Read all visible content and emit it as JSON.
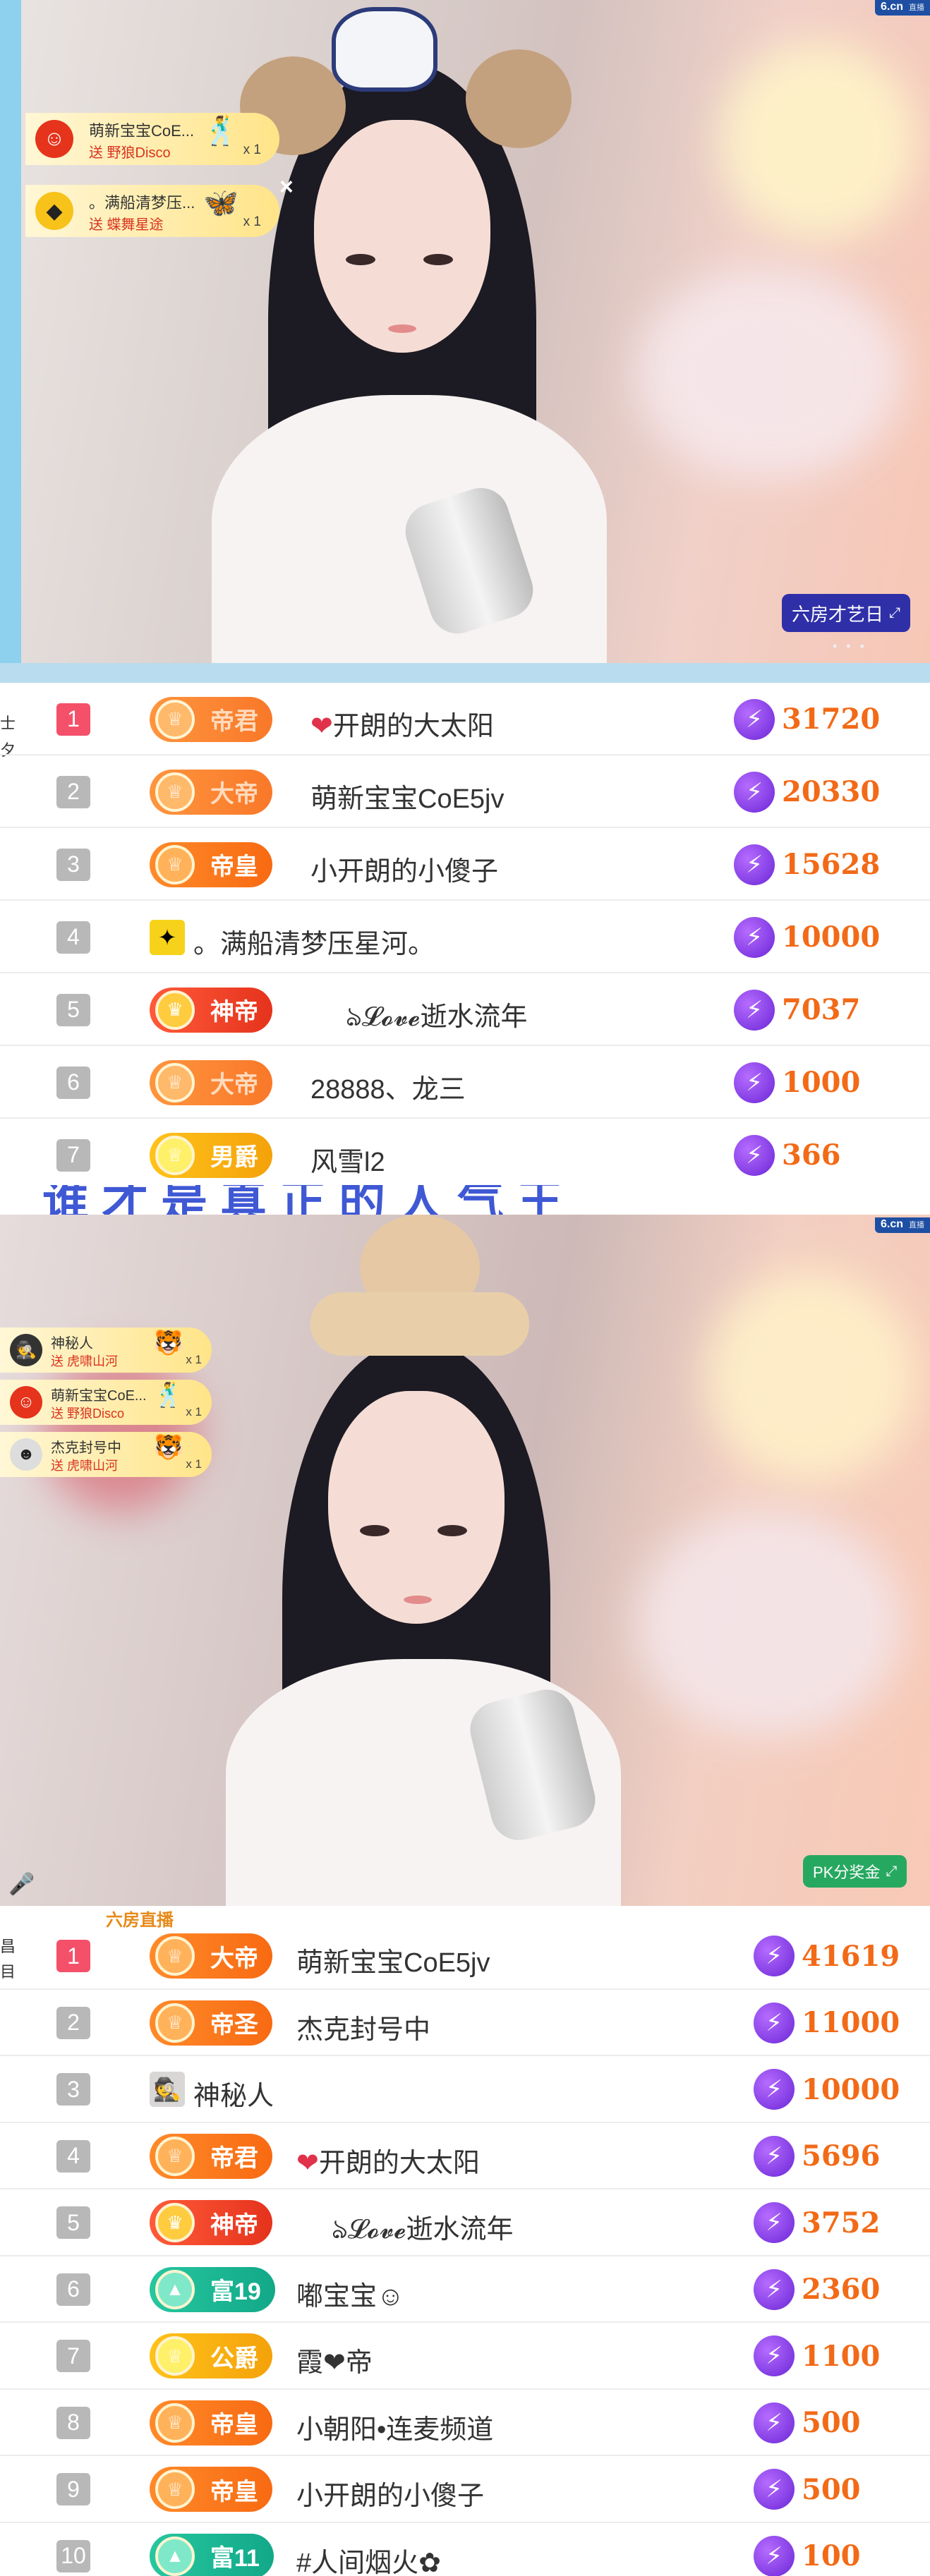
{
  "top_video": {
    "logo": "6.cn",
    "logo_sub": "直播",
    "gifts": [
      {
        "avatar": "☺",
        "name": "萌新宝宝CoE...",
        "action": "送 野狼Disco",
        "count": "x 1",
        "icon": "🕺"
      },
      {
        "avatar": "◆",
        "name": "。满船清梦压...",
        "action": "送 蝶舞星途",
        "count": "x 1",
        "icon": "🦋"
      }
    ],
    "close_icon": "×",
    "corner_badge": "六房才艺日",
    "corner_badge_icon": "⤢",
    "dots": "• • •"
  },
  "board1": {
    "edge_chars": [
      "士",
      "夕"
    ],
    "rows": [
      {
        "rank": "1",
        "badge": "帝君",
        "badge_style": "faded",
        "name_prefix": "❤",
        "name": "开朗的大太阳",
        "points": "31720"
      },
      {
        "rank": "2",
        "badge": "大帝",
        "badge_style": "faded",
        "name_prefix": "",
        "name": "萌新宝宝CoE5jv",
        "points": "20330"
      },
      {
        "rank": "3",
        "badge": "帝皇",
        "badge_style": "orange",
        "name_prefix": "",
        "name": "小开朗的小傻子",
        "points": "15628"
      },
      {
        "rank": "4",
        "badge": "",
        "badge_style": "avatar",
        "name_prefix": "",
        "name": "。满船清梦压星河。",
        "points": "10000"
      },
      {
        "rank": "5",
        "badge": "神帝",
        "badge_style": "red",
        "name_prefix": "",
        "name": "ঌ𝓛𝓸𝓿𝓮逝水流年",
        "points": "7037"
      },
      {
        "rank": "6",
        "badge": "大帝",
        "badge_style": "faded",
        "name_prefix": "",
        "name": "28888、龙三",
        "points": "1000"
      },
      {
        "rank": "7",
        "badge": "男爵",
        "badge_style": "gold",
        "name_prefix": "",
        "name": "风雪l2",
        "points": "366"
      }
    ]
  },
  "separator_text": "谁才是真正的人气王",
  "bottom_video": {
    "logo": "6.cn",
    "logo_sub": "直播",
    "gifts": [
      {
        "avatar": "🕵",
        "name": "神秘人",
        "action": "送 虎啸山河",
        "count": "x 1",
        "icon": "🐯"
      },
      {
        "avatar": "☺",
        "name": "萌新宝宝CoE...",
        "action": "送 野狼Disco",
        "count": "x 1",
        "icon": "🕺"
      },
      {
        "avatar": "☻",
        "name": "杰克封号中",
        "action": "送 虎啸山河",
        "count": "x 1",
        "icon": "🐯"
      }
    ],
    "corner_badge": "PK分奖金",
    "corner_badge_icon": "⤢",
    "mic_icon": "🎤"
  },
  "board2": {
    "sub_label": "六房直播",
    "edge_chars": [
      "昌",
      "目"
    ],
    "rows": [
      {
        "rank": "1",
        "badge": "大帝",
        "badge_style": "orange",
        "name_prefix": "",
        "name": "萌新宝宝CoE5jv",
        "points": "41619"
      },
      {
        "rank": "2",
        "badge": "帝圣",
        "badge_style": "orange",
        "name_prefix": "",
        "name": "杰克封号中",
        "points": "11000"
      },
      {
        "rank": "3",
        "badge": "",
        "badge_style": "avatar",
        "name_prefix": "",
        "name": "神秘人",
        "points": "10000"
      },
      {
        "rank": "4",
        "badge": "帝君",
        "badge_style": "orange",
        "name_prefix": "❤",
        "name": "开朗的大太阳",
        "points": "5696"
      },
      {
        "rank": "5",
        "badge": "神帝",
        "badge_style": "red",
        "name_prefix": "",
        "name": "ঌ𝓛𝓸𝓿𝓮逝水流年",
        "points": "3752"
      },
      {
        "rank": "6",
        "badge": "富19",
        "badge_style": "teal",
        "name_prefix": "",
        "name": "嘟宝宝☺",
        "points": "2360"
      },
      {
        "rank": "7",
        "badge": "公爵",
        "badge_style": "gold",
        "name_prefix": "",
        "name": "霞❤帝",
        "points": "1100"
      },
      {
        "rank": "8",
        "badge": "帝皇",
        "badge_style": "orange",
        "name_prefix": "",
        "name": "小朝阳•连麦频道",
        "points": "500"
      },
      {
        "rank": "9",
        "badge": "帝皇",
        "badge_style": "orange",
        "name_prefix": "",
        "name": "小开朗的小傻子",
        "points": "500"
      },
      {
        "rank": "10",
        "badge": "富11",
        "badge_style": "teal",
        "name_prefix": "",
        "name": "#人间烟火✿",
        "points": "100"
      }
    ]
  },
  "colors": {
    "rank_top": "#f4506a",
    "rank_other": "#b8b8b8",
    "points": "#f26a17",
    "bolt": "#7a32e0"
  }
}
